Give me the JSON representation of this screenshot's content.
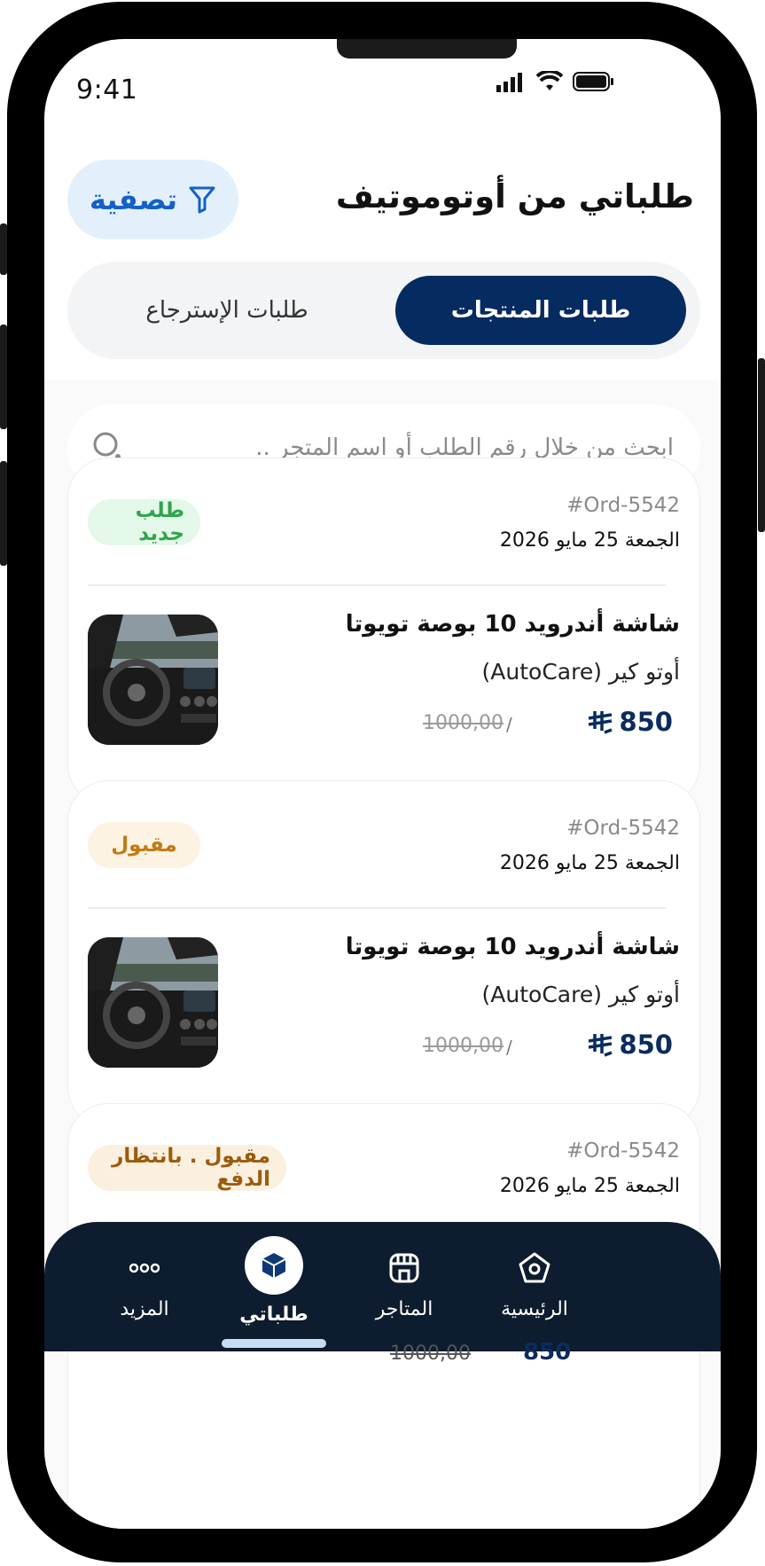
{
  "status_bar": {
    "time": "9:41"
  },
  "header": {
    "title": "طلباتي من أوتوموتيف",
    "filter_label": "تصفية"
  },
  "segments": {
    "active": "طلبات المنتجات",
    "other": "طلبات الإسترجاع"
  },
  "search": {
    "placeholder": "ابحث من خلال رقم الطلب أو اسم المتجر .."
  },
  "orders": [
    {
      "order_no": "#Ord-5542",
      "date": "الجمعة 25 مايو 2026",
      "status": "طلب جديد",
      "status_bg": "#e4f8e9",
      "status_color": "#2fa54c",
      "product": "شاشة أندرويد 10 بوصة تويوتا",
      "store": "أوتو كير (AutoCare)",
      "price": "850",
      "old_price": "1000,00"
    },
    {
      "order_no": "#Ord-5542",
      "date": "الجمعة 25 مايو 2026",
      "status": "مقبول",
      "status_bg": "#fdf3e3",
      "status_color": "#c27a14",
      "product": "شاشة أندرويد 10 بوصة تويوتا",
      "store": "أوتو كير (AutoCare)",
      "price": "850",
      "old_price": "1000,00"
    },
    {
      "order_no": "#Ord-5542",
      "date": "الجمعة 25 مايو 2026",
      "status": "مقبول . بانتظار الدفع",
      "status_bg": "#fbf0e0",
      "status_color": "#9a5c0c"
    }
  ],
  "bottom_nav": {
    "items": [
      {
        "label": "الرئيسية",
        "icon": "home-icon"
      },
      {
        "label": "المتاجر",
        "icon": "store-icon"
      },
      {
        "label": "طلباتي",
        "icon": "box-icon",
        "active": true
      },
      {
        "label": "المزيد",
        "icon": "more-dots-icon"
      }
    ]
  },
  "partial_row": {
    "old_price": "1000,00",
    "price": "850"
  },
  "colors": {
    "brand": "#062b60",
    "nav_bg": "#0d1c2e",
    "filter_bg": "#e3f0fc",
    "accent": "#1560c8"
  }
}
